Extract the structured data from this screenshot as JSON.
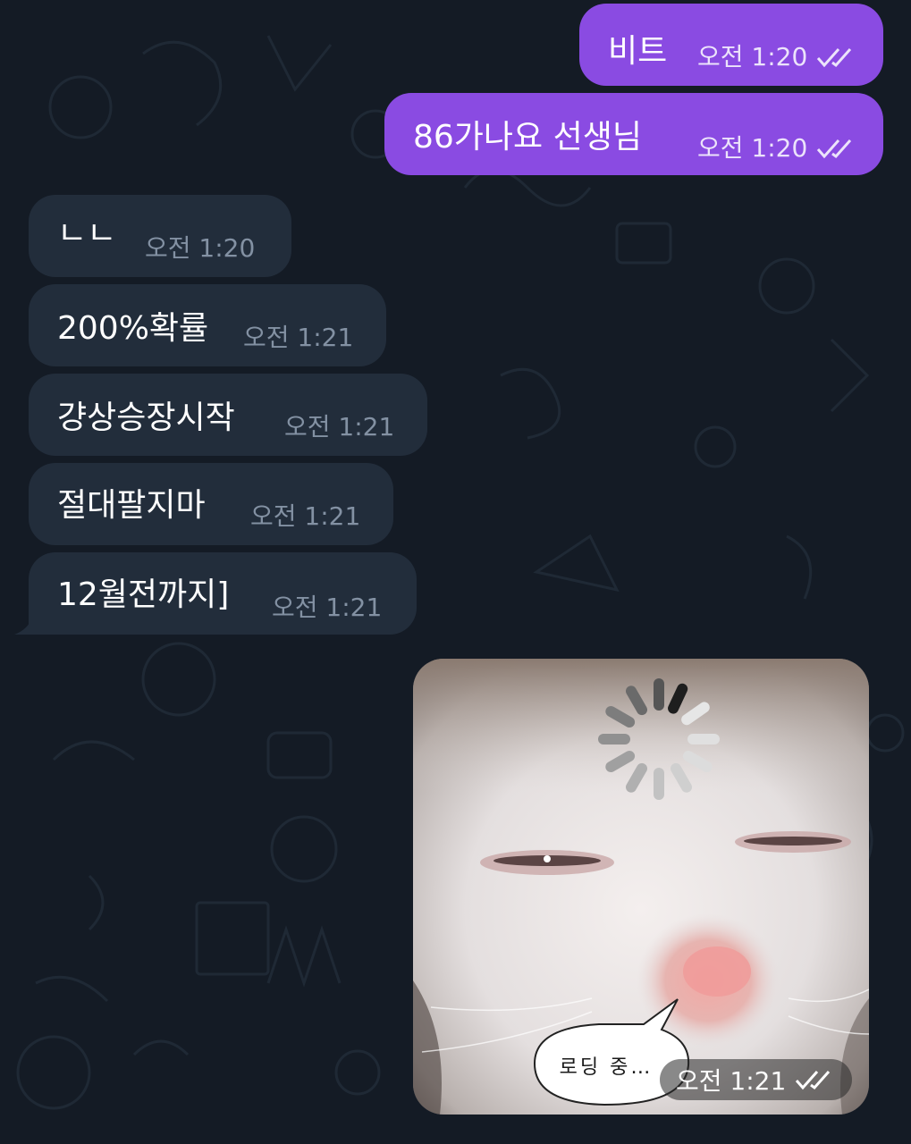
{
  "messages": [
    {
      "text": "비트",
      "time": "오전 1:20"
    },
    {
      "text": "86가나요 선생님",
      "time": "오전 1:20"
    },
    {
      "text": "ㄴㄴ",
      "time": "오전 1:20"
    },
    {
      "text": "200%확률",
      "time": "오전 1:21"
    },
    {
      "text": "걍상승장시작",
      "time": "오전 1:21"
    },
    {
      "text": "절대팔지마",
      "time": "오전 1:21"
    },
    {
      "text": "12월전까지]",
      "time": "오전 1:21"
    }
  ],
  "photo": {
    "speech_text": "로딩 중…",
    "time": "오전 1:21",
    "read_status_icon": "double-check-icon"
  },
  "colors": {
    "background": "#141b25",
    "outgoing_bubble": "#8a4be2",
    "incoming_bubble": "#222d3b",
    "incoming_time": "#8391a3"
  }
}
